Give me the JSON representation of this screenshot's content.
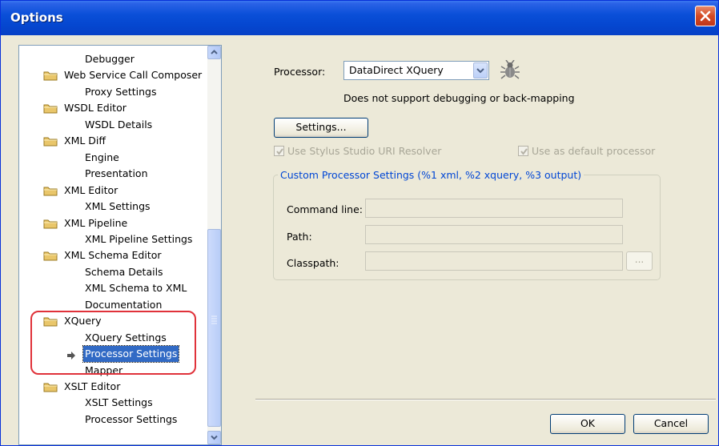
{
  "window": {
    "title": "Options"
  },
  "tree": {
    "items": [
      {
        "label": "Debugger",
        "level": 2
      },
      {
        "label": "Web Service Call Composer",
        "level": 1
      },
      {
        "label": "Proxy Settings",
        "level": 2
      },
      {
        "label": "WSDL Editor",
        "level": 1
      },
      {
        "label": "WSDL Details",
        "level": 2
      },
      {
        "label": "XML Diff",
        "level": 1
      },
      {
        "label": "Engine",
        "level": 2
      },
      {
        "label": "Presentation",
        "level": 2
      },
      {
        "label": "XML Editor",
        "level": 1
      },
      {
        "label": "XML Settings",
        "level": 2
      },
      {
        "label": "XML Pipeline",
        "level": 1
      },
      {
        "label": "XML Pipeline Settings",
        "level": 2
      },
      {
        "label": "XML Schema Editor",
        "level": 1
      },
      {
        "label": "Schema Details",
        "level": 2
      },
      {
        "label": "XML Schema to XML",
        "level": 2
      },
      {
        "label": "Documentation",
        "level": 2
      },
      {
        "label": "XQuery",
        "level": 1
      },
      {
        "label": "XQuery Settings",
        "level": 2
      },
      {
        "label": "Processor Settings",
        "level": 2,
        "selected": true
      },
      {
        "label": "Mapper",
        "level": 2
      },
      {
        "label": "XSLT Editor",
        "level": 1
      },
      {
        "label": "XSLT Settings",
        "level": 2
      },
      {
        "label": "Processor Settings",
        "level": 2
      }
    ]
  },
  "processor": {
    "label": "Processor:",
    "selected": "DataDirect XQuery",
    "note": "Does not support debugging or back-mapping",
    "settings_button": "Settings..."
  },
  "options": {
    "uri_resolver": "Use Stylus Studio URI Resolver",
    "default_processor": "Use as default processor"
  },
  "custom": {
    "title": "Custom Processor Settings (%1 xml, %2 xquery, %3 output)",
    "command_line_label": "Command line:",
    "path_label": "Path:",
    "classpath_label": "Classpath:",
    "command_line_value": "",
    "path_value": "",
    "classpath_value": "",
    "browse_label": "..."
  },
  "footer": {
    "ok": "OK",
    "cancel": "Cancel"
  },
  "colors": {
    "titlebar": "#0547d0",
    "selection": "#316ac5",
    "highlight": "#e0323a",
    "group_title": "#0046d5"
  }
}
